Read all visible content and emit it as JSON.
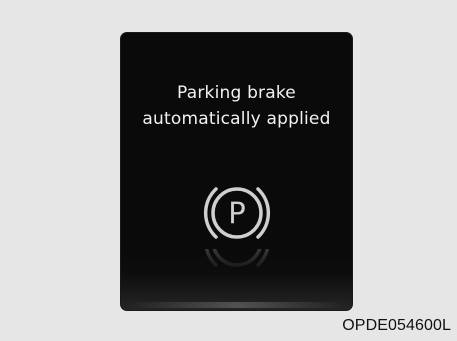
{
  "screen": {
    "message_line1": "Parking brake",
    "message_line2": "automatically applied",
    "icon": "parking-brake-icon",
    "icon_letter": "P"
  },
  "caption": {
    "code": "OPDE054600L"
  },
  "colors": {
    "page_background": "#e6e6e6",
    "screen_background": "#0a0a0a",
    "text": "#f2f2f2",
    "icon": "#d0d0d0"
  }
}
